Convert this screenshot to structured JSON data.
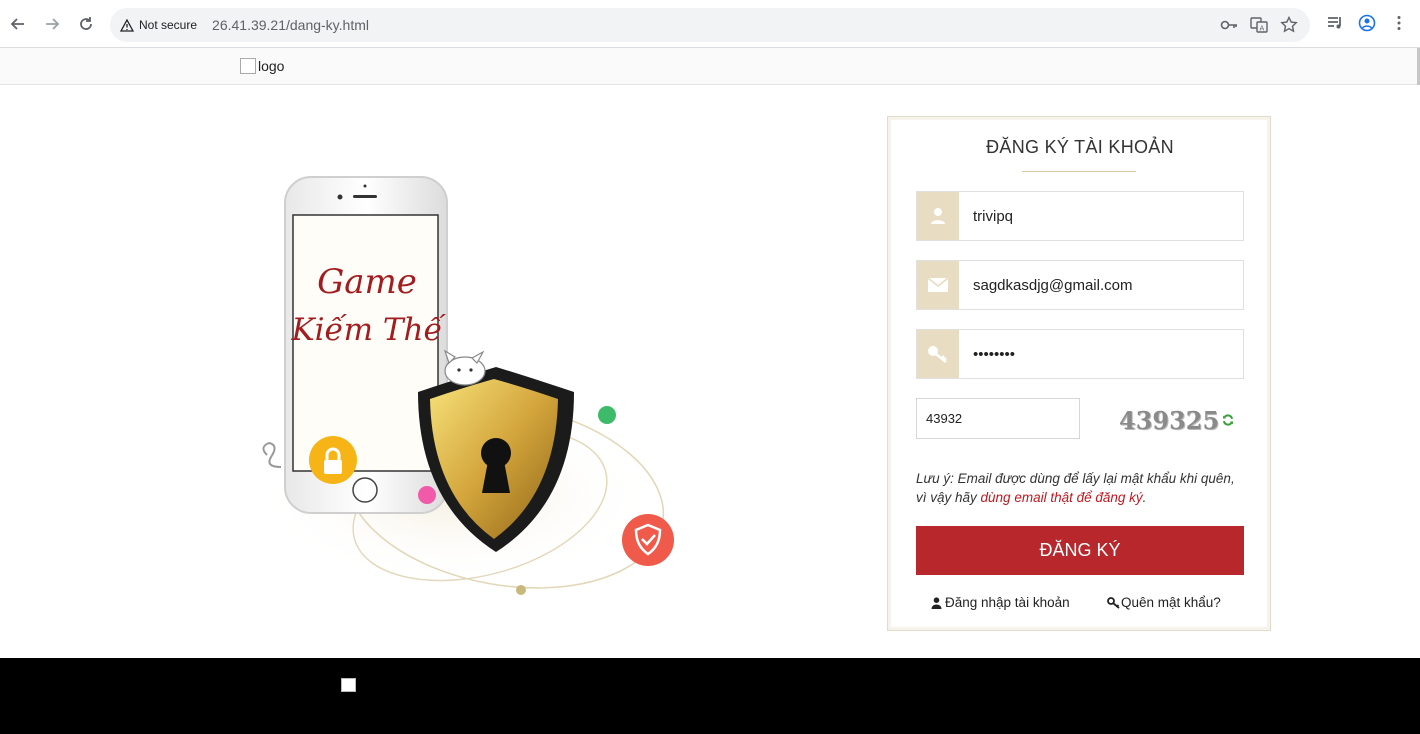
{
  "browser": {
    "security_label": "Not secure",
    "url": "26.41.39.21/dang-ky.html"
  },
  "header": {
    "logo_alt": "logo"
  },
  "illustration": {
    "phone_text_line1": "Game",
    "phone_text_line2": "Kiếm Thế"
  },
  "form": {
    "title": "ĐĂNG KÝ TÀI KHOẢN",
    "username_value": "trivipq",
    "email_value": "sagdkasdjg@gmail.com",
    "password_value": "••••••••",
    "captcha_input_value": "43932",
    "captcha_image_text": "439325",
    "note_prefix": "Lưu ý: Email được dùng để lấy lại mật khẩu khi quên, vì vậy hãy ",
    "note_highlight": "dùng email thật để đăng ký",
    "note_suffix": ".",
    "submit_label": "ĐĂNG KÝ",
    "login_link": "Đăng nhập tài khoản",
    "forgot_link": "Quên mật khẩu?"
  },
  "colors": {
    "submit_bg": "#b8272b",
    "icon_box_bg": "#e8dcc2",
    "note_highlight": "#c0171f"
  }
}
